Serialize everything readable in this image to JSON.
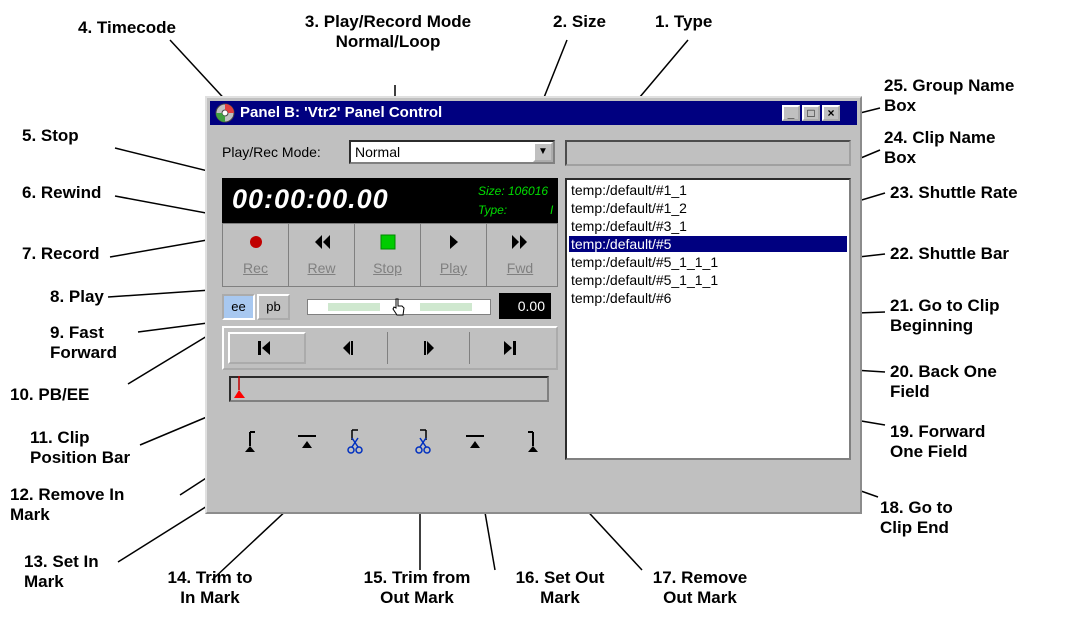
{
  "window": {
    "title": "Panel B: 'Vtr2' Panel Control",
    "minimize_glyph": "_",
    "maximize_glyph": "□",
    "close_glyph": "×"
  },
  "mode": {
    "label": "Play/Rec Mode:",
    "value": "Normal",
    "dropdown_glyph": "▼"
  },
  "display": {
    "timecode": "00:00:00.00",
    "size_text": "Size: 106016",
    "type_label": "Type:",
    "type_value": "I"
  },
  "transport": [
    {
      "key": "rec",
      "label": "Rec",
      "icon": "record-icon"
    },
    {
      "key": "rew",
      "label": "Rew",
      "icon": "rewind-icon"
    },
    {
      "key": "stop",
      "label": "Stop",
      "icon": "stop-icon"
    },
    {
      "key": "play",
      "label": "Play",
      "icon": "play-icon"
    },
    {
      "key": "fwd",
      "label": "Fwd",
      "icon": "fast-forward-icon"
    }
  ],
  "ee_label": "ee",
  "pb_label": "pb",
  "shuttle_rate": "0.00",
  "clips": [
    "temp:/default/#1_1",
    "temp:/default/#1_2",
    "temp:/default/#3_1",
    "temp:/default/#5",
    "temp:/default/#5_1_1_1",
    "temp:/default/#5_1_1_1",
    "temp:/default/#6"
  ],
  "selected_clip_index": 3,
  "colors": {
    "titlebar": "#000080",
    "selection": "#000080",
    "record": "#c00000",
    "stop": "#00cc00",
    "status_green": "#00dd00"
  },
  "callouts": {
    "c1": "1. Type",
    "c2": "2. Size",
    "c3": "3. Play/Record Mode\nNormal/Loop",
    "c4": "4. Timecode",
    "c5": "5. Stop",
    "c6": "6. Rewind",
    "c7": "7. Record",
    "c8": "8. Play",
    "c9": "9. Fast\nForward",
    "c10": "10. PB/EE",
    "c11": "11. Clip\nPosition Bar",
    "c12": "12. Remove In\nMark",
    "c13": "13. Set In\nMark",
    "c14": "14. Trim to\nIn Mark",
    "c15": "15. Trim from\nOut Mark",
    "c16": "16. Set Out\nMark",
    "c17": "17. Remove\nOut Mark",
    "c18": "18. Go to\nClip End",
    "c19": "19. Forward\nOne Field",
    "c20": "20. Back One\nField",
    "c21": "21. Go to Clip\nBeginning",
    "c22": "22. Shuttle Bar",
    "c23": "23. Shuttle Rate",
    "c24": "24. Clip Name\nBox",
    "c25": "25. Group Name\nBox"
  }
}
